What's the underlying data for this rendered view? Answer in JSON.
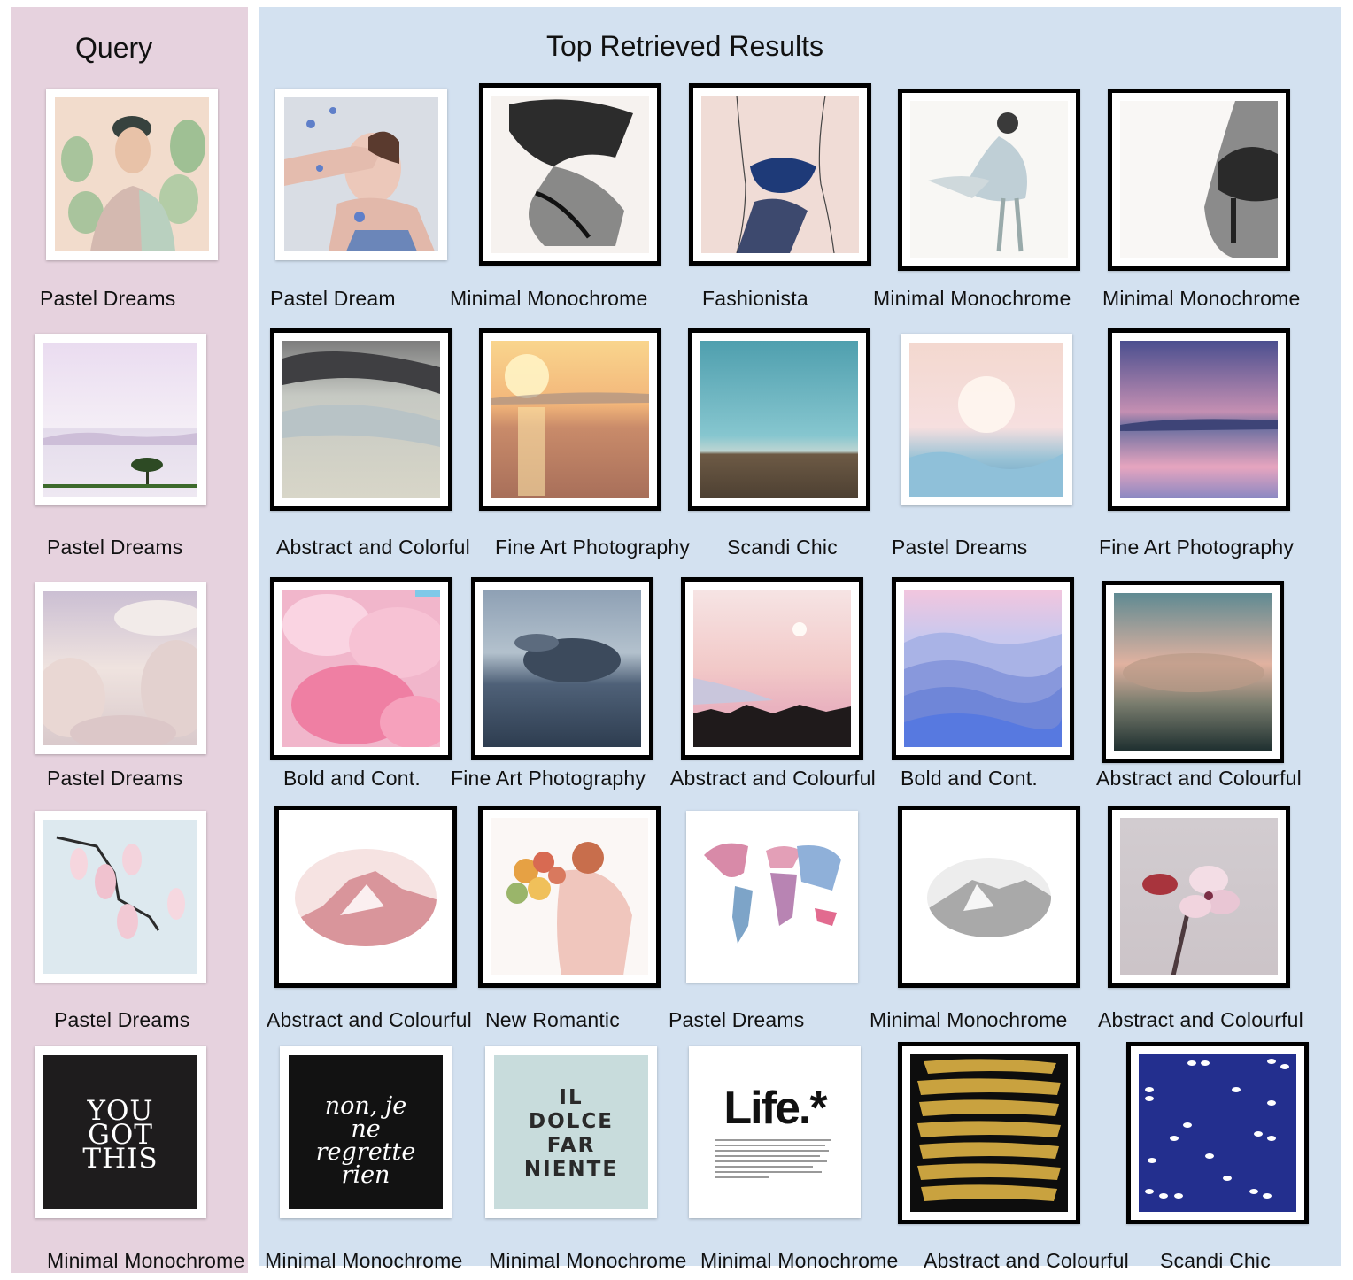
{
  "query": {
    "title": "Query",
    "items": [
      {
        "label": "Pastel Dreams",
        "art": "portrait-cactus"
      },
      {
        "label": "Pastel Dreams",
        "art": "lone-tree-lake"
      },
      {
        "label": "Pastel Dreams",
        "art": "pastel-clouds"
      },
      {
        "label": "Pastel Dreams",
        "art": "magnolia-branch"
      },
      {
        "label": "Minimal Monochrome",
        "art": "typography-black",
        "text": "YOU GOT THIS"
      }
    ]
  },
  "results": {
    "title": "Top Retrieved Results",
    "rows": [
      [
        {
          "label": "Pastel Dream",
          "art": "woman-butterflies"
        },
        {
          "label": "Minimal Monochrome",
          "art": "ink-figure"
        },
        {
          "label": "Fashionista",
          "art": "line-figure"
        },
        {
          "label": "Minimal Monochrome",
          "art": "watercolor-dancer"
        },
        {
          "label": "Minimal Monochrome",
          "art": "ink-lace"
        }
      ],
      [
        {
          "label": "Abstract and Colorful",
          "art": "abstract-landscape"
        },
        {
          "label": "Fine Art Photography",
          "art": "sunset-surf"
        },
        {
          "label": "Scandi Chic",
          "art": "teal-landscape"
        },
        {
          "label": "Pastel Dreams",
          "art": "moon-sea"
        },
        {
          "label": "Fine Art Photography",
          "art": "purple-lake"
        }
      ],
      [
        {
          "label": "Bold and Cont.",
          "art": "pink-clouds"
        },
        {
          "label": "Fine Art Photography",
          "art": "grey-clouds"
        },
        {
          "label": "Abstract and Colourful",
          "art": "pink-sky-forest"
        },
        {
          "label": "Bold and Cont.",
          "art": "blue-mountains"
        },
        {
          "label": "Abstract and Colourful",
          "art": "dark-sky"
        }
      ],
      [
        {
          "label": "Abstract and Colourful",
          "art": "pink-mountain-oval"
        },
        {
          "label": "New Romantic",
          "art": "flower-bouquet"
        },
        {
          "label": "Pastel Dreams",
          "art": "world-map"
        },
        {
          "label": "Minimal Monochrome",
          "art": "grey-mountain-oval"
        },
        {
          "label": "Abstract and Colourful",
          "art": "blossom"
        }
      ],
      [
        {
          "label": "Minimal Monochrome",
          "art": "script-black",
          "text": "non, je ne regrette rien"
        },
        {
          "label": "Minimal Monochrome",
          "art": "dolce-far-niente",
          "text": "IL DOLCE FAR NIENTE"
        },
        {
          "label": "Minimal Monochrome",
          "art": "life-poster",
          "text": "Life.*"
        },
        {
          "label": "Abstract and Colourful",
          "art": "gold-stripes"
        },
        {
          "label": "Scandi Chic",
          "art": "navy-dots"
        }
      ]
    ]
  },
  "colors": {
    "query_panel": "#e6d2de",
    "results_panel": "#d3e1f0"
  }
}
